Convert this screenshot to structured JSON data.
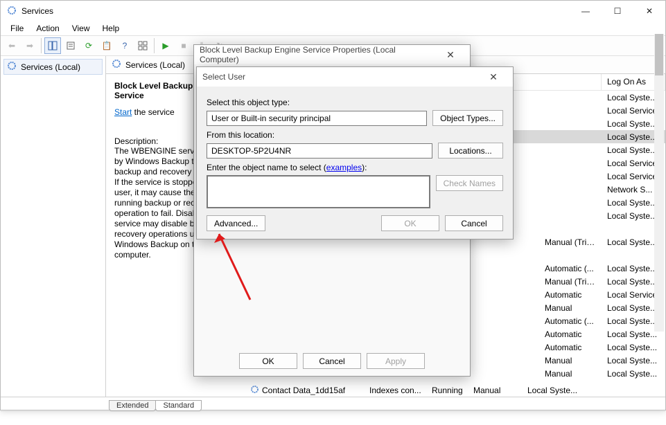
{
  "window": {
    "title": "Services",
    "controls": {
      "min": "—",
      "max": "☐",
      "close": "✕"
    }
  },
  "menubar": [
    "File",
    "Action",
    "View",
    "Help"
  ],
  "nav": {
    "item": "Services (Local)"
  },
  "content_header": "Services (Local)",
  "detail": {
    "heading": "Block Level Backup Engine Service",
    "start_link": "Start",
    "start_rest": " the service",
    "desc_label": "Description:",
    "description": "The WBENGINE service is used by Windows Backup to perform backup and recovery operations. If the service is stopped by a user, it may cause the currently running backup or recovery operation to fail. Disabling this service may disable backup and recovery operations using Windows Backup on this computer."
  },
  "list": {
    "columns": {
      "logon": "Log On As"
    },
    "rows": [
      {
        "startup": "",
        "logon": "Local Syste..."
      },
      {
        "startup": "",
        "logon": "Local Service"
      },
      {
        "startup": "",
        "logon": "Local Syste..."
      },
      {
        "startup": "",
        "logon": "Local Syste...",
        "selected": true
      },
      {
        "startup": "",
        "logon": "Local Syste..."
      },
      {
        "startup": "",
        "logon": "Local Service"
      },
      {
        "startup": "",
        "logon": "Local Service"
      },
      {
        "startup": "",
        "logon": "Network S..."
      },
      {
        "startup": "",
        "logon": "Local Syste..."
      },
      {
        "startup": "",
        "logon": "Local Syste..."
      },
      {
        "startup": "",
        "logon": ""
      },
      {
        "startup": "Manual (Trig...",
        "logon": "Local Syste..."
      },
      {
        "startup": "",
        "logon": ""
      },
      {
        "startup": "Automatic (...",
        "logon": "Local Syste..."
      },
      {
        "startup": "Manual (Trig...",
        "logon": "Local Syste..."
      },
      {
        "startup": "Automatic",
        "logon": "Local Service"
      },
      {
        "startup": "Manual",
        "logon": "Local Syste..."
      },
      {
        "startup": "Automatic (...",
        "logon": "Local Syste..."
      },
      {
        "startup": "Automatic",
        "logon": "Local Syste..."
      },
      {
        "startup": "Automatic",
        "logon": "Local Syste..."
      },
      {
        "startup": "Manual",
        "logon": "Local Syste..."
      },
      {
        "startup": "Manual",
        "logon": "Local Syste..."
      }
    ],
    "bottom_row": {
      "name": "Contact Data_1dd15af",
      "desc": "Indexes con...",
      "status": "Running",
      "startup": "Manual",
      "logon": "Local Syste..."
    }
  },
  "tabs": {
    "extended": "Extended",
    "standard": "Standard"
  },
  "dialog_props": {
    "title": "Block Level Backup Engine Service Properties (Local Computer)",
    "ok": "OK",
    "cancel": "Cancel",
    "apply": "Apply"
  },
  "dialog_select": {
    "title": "Select User",
    "object_type_label": "Select this object type:",
    "object_type_value": "User or Built-in security principal",
    "object_types_btn": "Object Types...",
    "location_label": "From this location:",
    "location_value": "DESKTOP-5P2U4NR",
    "locations_btn": "Locations...",
    "enter_name_label_1": "Enter the object name to select (",
    "enter_name_examples": "examples",
    "enter_name_label_2": "):",
    "check_names_btn": "Check Names",
    "advanced_btn": "Advanced...",
    "ok": "OK",
    "cancel": "Cancel"
  }
}
